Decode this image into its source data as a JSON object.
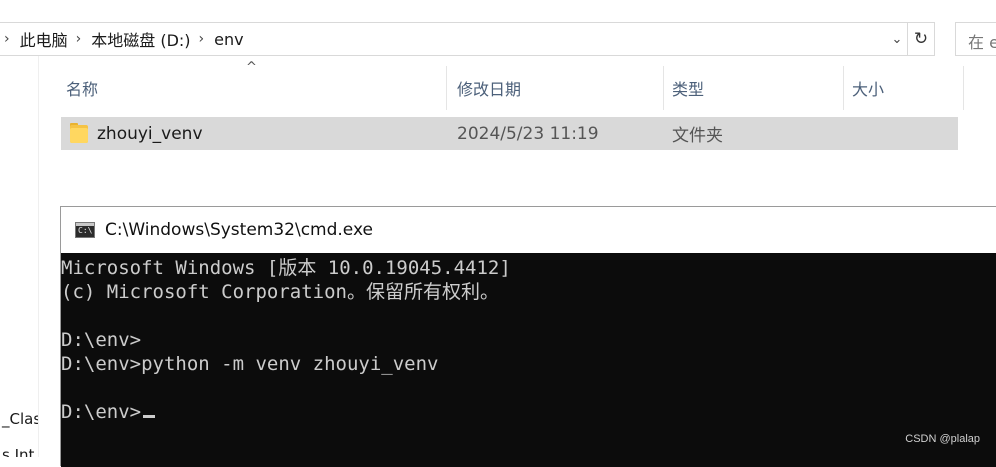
{
  "explorer": {
    "breadcrumb": [
      "此电脑",
      "本地磁盘 (D:)",
      "env"
    ],
    "search_placeholder_fragment": "在 e",
    "nav_items": [
      "_Clas",
      "s Int"
    ],
    "columns": [
      "名称",
      "修改日期",
      "类型",
      "大小"
    ],
    "files": [
      {
        "name": "zhouyi_venv",
        "modified": "2024/5/23 11:19",
        "type": "文件夹",
        "size": "",
        "icon": "folder-icon"
      }
    ]
  },
  "cmd": {
    "title": "C:\\Windows\\System32\\cmd.exe",
    "lines": [
      "Microsoft Windows [版本 10.0.19045.4412]",
      "(c) Microsoft Corporation。保留所有权利。",
      "",
      "D:\\env>",
      "D:\\env>python -m venv zhouyi_venv",
      "",
      "D:\\env>"
    ]
  },
  "watermark": "CSDN @plalap",
  "colors": {
    "selected_row": "#d9d9d9",
    "column_header_text": "#4c607a",
    "console_bg": "#0c0c0c",
    "console_text": "#cccccc",
    "folder": "#ffd760"
  }
}
